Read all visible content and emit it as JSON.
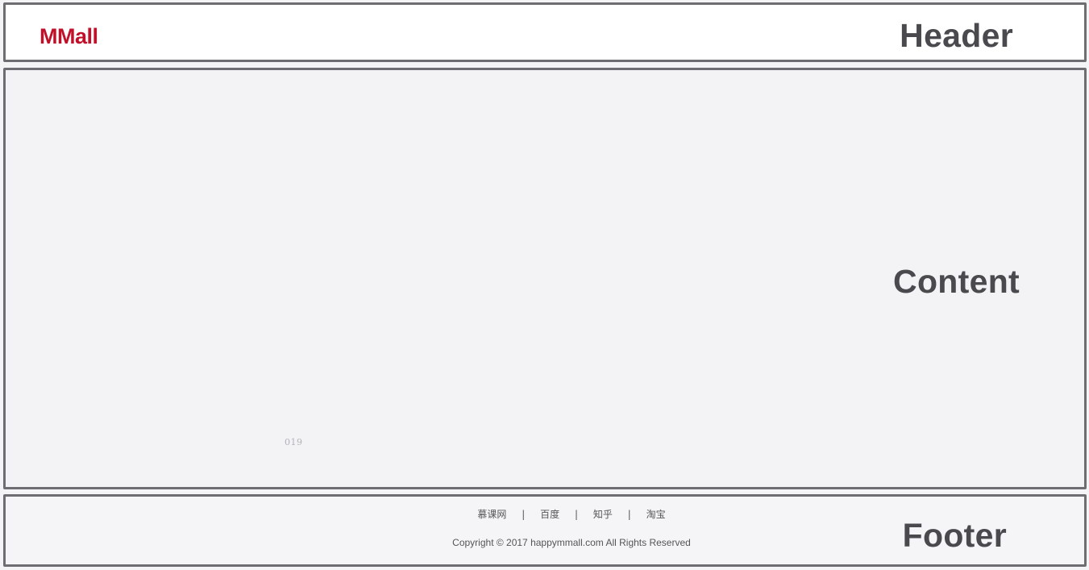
{
  "header": {
    "logo": "MMall",
    "region_label": "Header"
  },
  "content": {
    "region_label": "Content",
    "watermark": "019"
  },
  "footer": {
    "region_label": "Footer",
    "links": [
      "慕课网",
      "百度",
      "知乎",
      "淘宝"
    ],
    "separator": "|",
    "copyright": "Copyright © 2017 happymmall.com All Rights Reserved"
  },
  "colors": {
    "brand": "#c0102a",
    "label": "#4a4a4e",
    "border": "#6e6e72"
  }
}
